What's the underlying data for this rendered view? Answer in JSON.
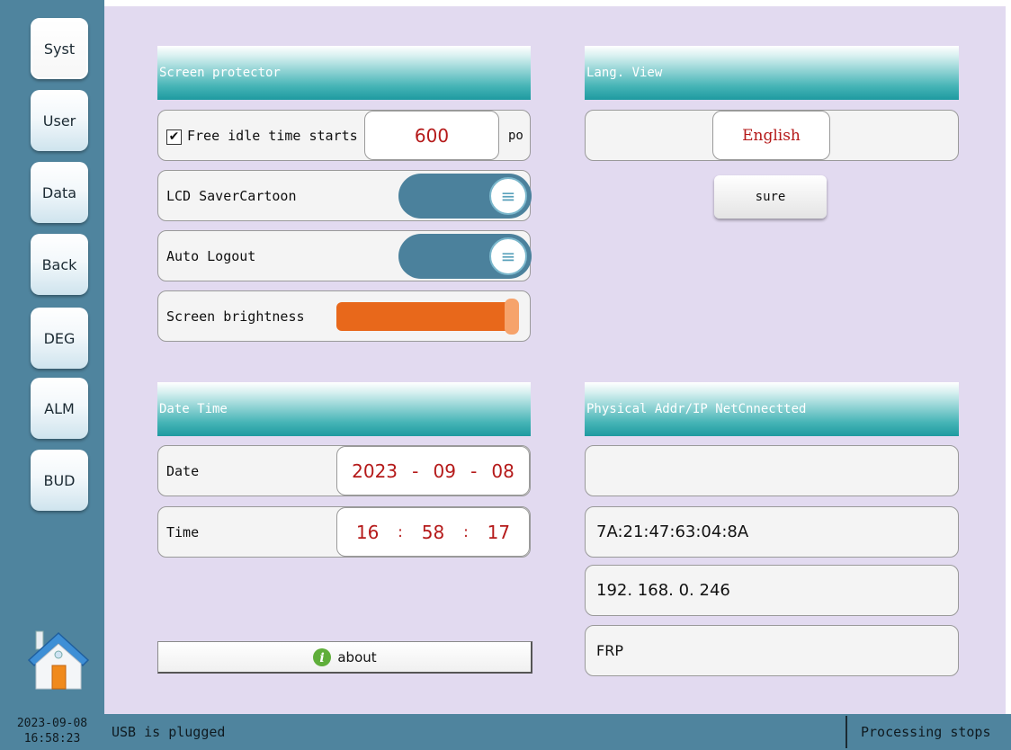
{
  "sidebar": {
    "items": [
      {
        "label": "Syst",
        "active": true
      },
      {
        "label": "User"
      },
      {
        "label": "Data"
      },
      {
        "label": "Back"
      },
      {
        "label": "DEG"
      },
      {
        "label": "ALM"
      },
      {
        "label": "BUD"
      }
    ],
    "home_icon": "home-icon"
  },
  "screen_protector": {
    "title": "Screen protector",
    "idle": {
      "checked": true,
      "check_mark": "✔",
      "label": "Free idle time starts",
      "value": "600",
      "unit": "po"
    },
    "lcd_saver": {
      "label": "LCD SaverCartoon",
      "on": true
    },
    "auto_logout": {
      "label": "Auto Logout",
      "on": true
    },
    "brightness": {
      "label": "Screen brightness",
      "level_percent": 100
    }
  },
  "language": {
    "title": "Lang. View",
    "selected": "English",
    "sure_label": "sure"
  },
  "datetime": {
    "title": "Date Time",
    "date_label": "Date",
    "year": "2023",
    "month": "09",
    "day": "08",
    "date_sep": "-",
    "time_label": "Time",
    "hour": "16",
    "minute": "58",
    "second": "17",
    "time_sep": ":"
  },
  "network": {
    "title": "Physical Addr/IP NetCnnectted",
    "field1": "",
    "mac": "7A:21:47:63:04:8A",
    "ip": "192. 168. 0. 246",
    "name": "FRP"
  },
  "about": {
    "label": "about",
    "icon": "info-icon"
  },
  "status": {
    "date": "2023-09-08",
    "time": "16:58:23",
    "message": "USB is plugged",
    "state": "Processing stops"
  },
  "colors": {
    "accent_teal": "#1e9aa0",
    "sidebar": "#4f849e",
    "panel": "#e2daf0",
    "value_red": "#b51a1a",
    "slider": "#e8681b"
  }
}
